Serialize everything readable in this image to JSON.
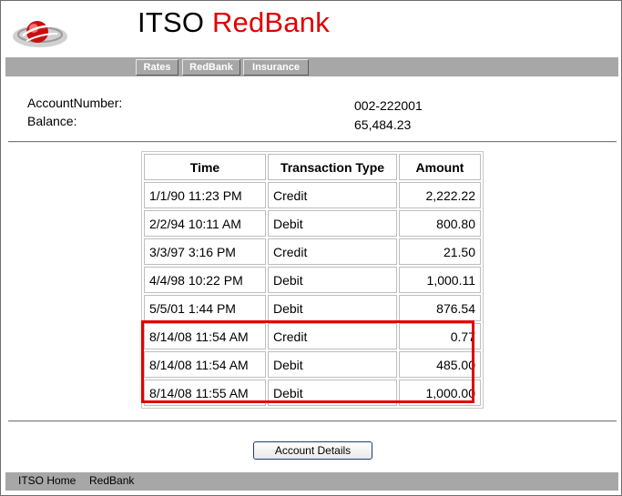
{
  "header": {
    "title_part1": "ITSO",
    "title_part2": "RedBank",
    "logo_icon": "itso-redbank-logo-icon"
  },
  "nav": {
    "items": [
      {
        "label": "Rates"
      },
      {
        "label": "RedBank"
      },
      {
        "label": "Insurance"
      }
    ]
  },
  "account": {
    "number_label": "AccountNumber:",
    "number_value": "002-222001",
    "balance_label": "Balance:",
    "balance_value": "65,484.23"
  },
  "transactions": {
    "columns": [
      "Time",
      "Transaction Type",
      "Amount"
    ],
    "rows": [
      {
        "time": "1/1/90 11:23 PM",
        "type": "Credit",
        "amount": "2,222.22"
      },
      {
        "time": "2/2/94 10:11 AM",
        "type": "Debit",
        "amount": "800.80"
      },
      {
        "time": "3/3/97 3:16 PM",
        "type": "Credit",
        "amount": "21.50"
      },
      {
        "time": "4/4/98 10:22 PM",
        "type": "Debit",
        "amount": "1,000.11"
      },
      {
        "time": "5/5/01 1:44 PM",
        "type": "Debit",
        "amount": "876.54"
      },
      {
        "time": "8/14/08 11:54 AM",
        "type": "Credit",
        "amount": "0.77"
      },
      {
        "time": "8/14/08 11:54 AM",
        "type": "Debit",
        "amount": "485.00"
      },
      {
        "time": "8/14/08 11:55 AM",
        "type": "Debit",
        "amount": "1,000.00"
      }
    ],
    "highlight_color": "#e00000"
  },
  "actions": {
    "account_details_label": "Account Details"
  },
  "footer": {
    "links": [
      {
        "label": "ITSO Home"
      },
      {
        "label": "RedBank"
      }
    ]
  },
  "colors": {
    "brand_red": "#e00000",
    "bar_gray": "#a7a7a7"
  }
}
